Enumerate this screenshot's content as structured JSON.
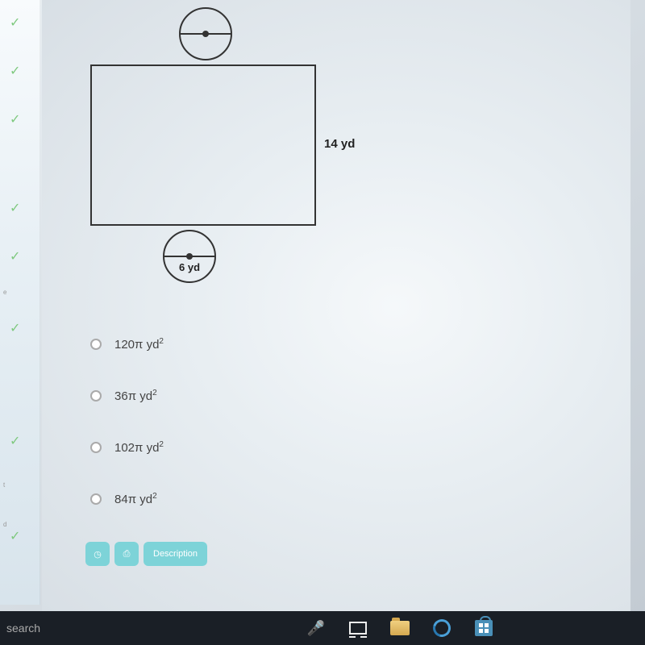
{
  "sidebar": {
    "checks": [
      "✓",
      "✓",
      "✓",
      "✓",
      "✓",
      "✓",
      "✓",
      "✓"
    ],
    "small_labels": [
      "e",
      "t",
      "d"
    ]
  },
  "figure": {
    "rect_side_label": "14 yd",
    "bottom_circle_label": "6 yd"
  },
  "options": [
    {
      "text_prefix": "120",
      "symbol": "π",
      "unit": "yd",
      "sup": "2"
    },
    {
      "text_prefix": "36",
      "symbol": "π",
      "unit": "yd",
      "sup": "2"
    },
    {
      "text_prefix": "102",
      "symbol": "π",
      "unit": "yd",
      "sup": "2"
    },
    {
      "text_prefix": "84",
      "symbol": "π",
      "unit": "yd",
      "sup": "2"
    }
  ],
  "buttons": {
    "clock_icon": "◷",
    "print_icon": "⎙",
    "description": "Description"
  },
  "taskbar": {
    "search_text": "search",
    "mic_glyph": "🎤"
  }
}
